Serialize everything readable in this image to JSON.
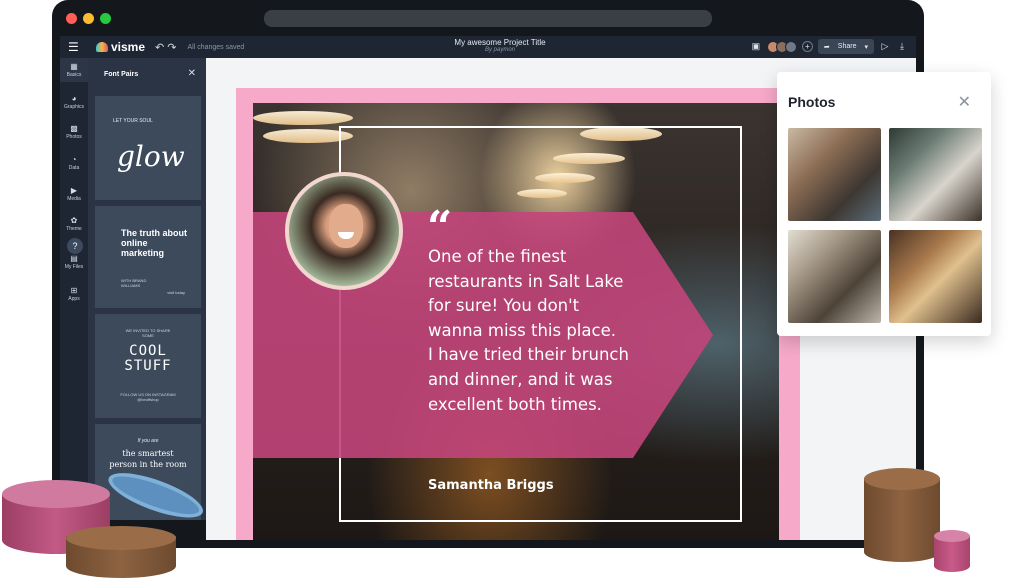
{
  "app": {
    "brand": "visme",
    "save_status": "All changes saved",
    "project_title": "My awesome Project Title",
    "project_author": "By paymon",
    "share_label": "Share"
  },
  "rail": {
    "items": [
      {
        "label": "Basics",
        "icon": "grid-icon"
      },
      {
        "label": "Graphics",
        "icon": "shapes-icon"
      },
      {
        "label": "Photos",
        "icon": "image-icon"
      },
      {
        "label": "Data",
        "icon": "chart-icon"
      },
      {
        "label": "Media",
        "icon": "play-icon"
      },
      {
        "label": "Theme",
        "icon": "palette-icon"
      },
      {
        "label": "My Files",
        "icon": "folder-icon"
      },
      {
        "label": "Apps",
        "icon": "apps-icon"
      }
    ],
    "help": "?"
  },
  "font_panel": {
    "title": "Font Pairs",
    "cards": [
      {
        "small": "LET YOUR SOUL",
        "big": "glow"
      },
      {
        "big": "The truth about online marketing",
        "by": "WITH BRAND WILLIAMS",
        "side": "visit today"
      },
      {
        "small": "WE INVITED TO SHARE SOME",
        "big": "COOL STUFF",
        "foot": "FOLLOW US ON INSTAGRAM @beoffshop"
      },
      {
        "small": "If you are",
        "big": "the smartest person in the room"
      }
    ]
  },
  "slide": {
    "quote_mark": "“",
    "quote_lines": [
      "One of the finest",
      "restaurants in Salt Lake",
      "for sure! You don't",
      "wanna miss this place.",
      "I have tried their brunch",
      "and dinner, and it was",
      "excellent both times."
    ],
    "author": "Samantha Briggs",
    "accent_color": "#c2457a",
    "border_color": "#f6a9c9"
  },
  "photos_panel": {
    "title": "Photos",
    "thumbs": [
      "restaurant-table-photo",
      "chef-kitchen-photo",
      "diner-group-photo",
      "toast-dinner-photo"
    ]
  }
}
